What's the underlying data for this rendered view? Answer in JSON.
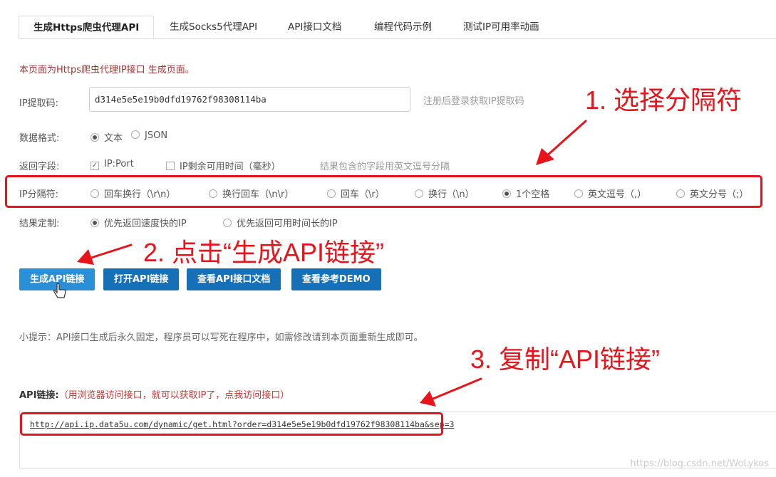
{
  "tabs": [
    "生成Https爬虫代理API",
    "生成Socks5代理API",
    "API接口文档",
    "编程代码示例",
    "测试IP可用率动画"
  ],
  "notice": "本页面为Https爬虫代理IP接口 生成页面。",
  "ip_code": {
    "label": "IP提取码:",
    "value": "d314e5e5e19b0dfd19762f98308114ba",
    "hint": "注册后登录获取IP提取码"
  },
  "format": {
    "label": "数据格式:",
    "options": [
      "文本",
      "JSON"
    ]
  },
  "fields": {
    "label": "返回字段:",
    "options": [
      "IP:Port",
      "IP剩余可用时间（毫秒）"
    ],
    "hint": "结果包含的字段用英文逗号分隔"
  },
  "separator": {
    "label": "IP分隔符:",
    "options": [
      "回车换行（\\r\\n）",
      "换行回车（\\n\\r）",
      "回车（\\r）",
      "换行（\\n）",
      "1个空格",
      "英文逗号（,）",
      "英文分号（;）"
    ]
  },
  "custom": {
    "label": "结果定制:",
    "options": [
      "优先返回速度快的IP",
      "优先返回可用时间长的IP"
    ]
  },
  "buttons": [
    "生成API链接",
    "打开API链接",
    "查看API接口文档",
    "查看参考DEMO"
  ],
  "tip": "小提示：API接口生成后永久固定，程序员可以写死在程序中，如需修改请到本页面重新生成即可。",
  "api": {
    "label": "API链接:",
    "note": "（用浏览器访问接口，就可以获取IP了，点我访问接口）",
    "url": "http://api.ip.data5u.com/dynamic/get.html?order=d314e5e5e19b0dfd19762f98308114ba&sep=3"
  },
  "annotations": [
    "1. 选择分隔符",
    "2. 点击“生成API链接”",
    "3. 复制“API链接”"
  ],
  "watermark": "https://blog.csdn.net/WoLykos",
  "colors": {
    "accent": "#1570b8",
    "annotation": "#e8141b"
  }
}
